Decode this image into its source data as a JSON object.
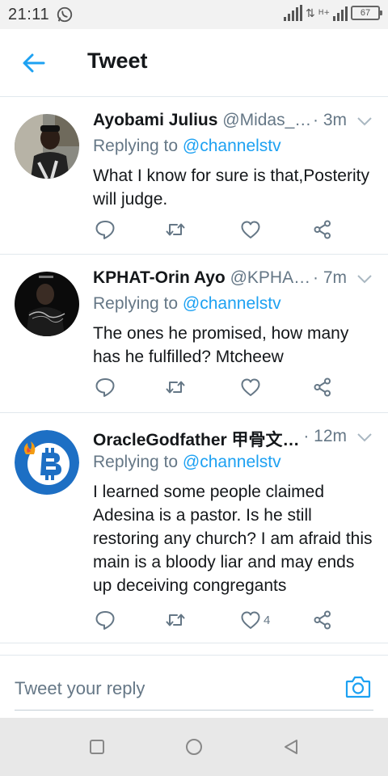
{
  "status_bar": {
    "time": "21:11",
    "battery": "67",
    "network_label": "H+"
  },
  "header": {
    "title": "Tweet"
  },
  "tweets": [
    {
      "name": "Ayobami Julius",
      "handle": "@Midas_…",
      "time": "· 3m",
      "replying_prefix": "Replying to ",
      "replying_to": "@channelstv",
      "text": "What I know for sure is that,Posterity will judge.",
      "like_count": ""
    },
    {
      "name": "KPHAT-Orin Ayo",
      "handle": "@KPHA…",
      "time": "· 7m",
      "replying_prefix": "Replying to ",
      "replying_to": "@channelstv",
      "text": "The ones he promised, how many has he fulfilled? Mtcheew",
      "like_count": ""
    },
    {
      "name": "OracleGodfather 甲骨文…",
      "handle": "",
      "time": "· 12m",
      "replying_prefix": "Replying to ",
      "replying_to": "@channelstv",
      "text": "I learned some people claimed Adesina is a pastor. Is he still restoring any church? I am afraid this main is a bloody liar and may ends up deceiving congregants",
      "like_count": "4"
    }
  ],
  "reply": {
    "placeholder": "Tweet your reply"
  },
  "icons": {
    "back": "arrow-left-icon",
    "reply": "reply-icon",
    "retweet": "retweet-icon",
    "like": "heart-icon",
    "share": "share-icon",
    "camera": "camera-icon",
    "more": "chevron-down-icon"
  },
  "colors": {
    "accent": "#1da1f2",
    "secondary_text": "#657786",
    "divider": "#e1e8ed"
  }
}
